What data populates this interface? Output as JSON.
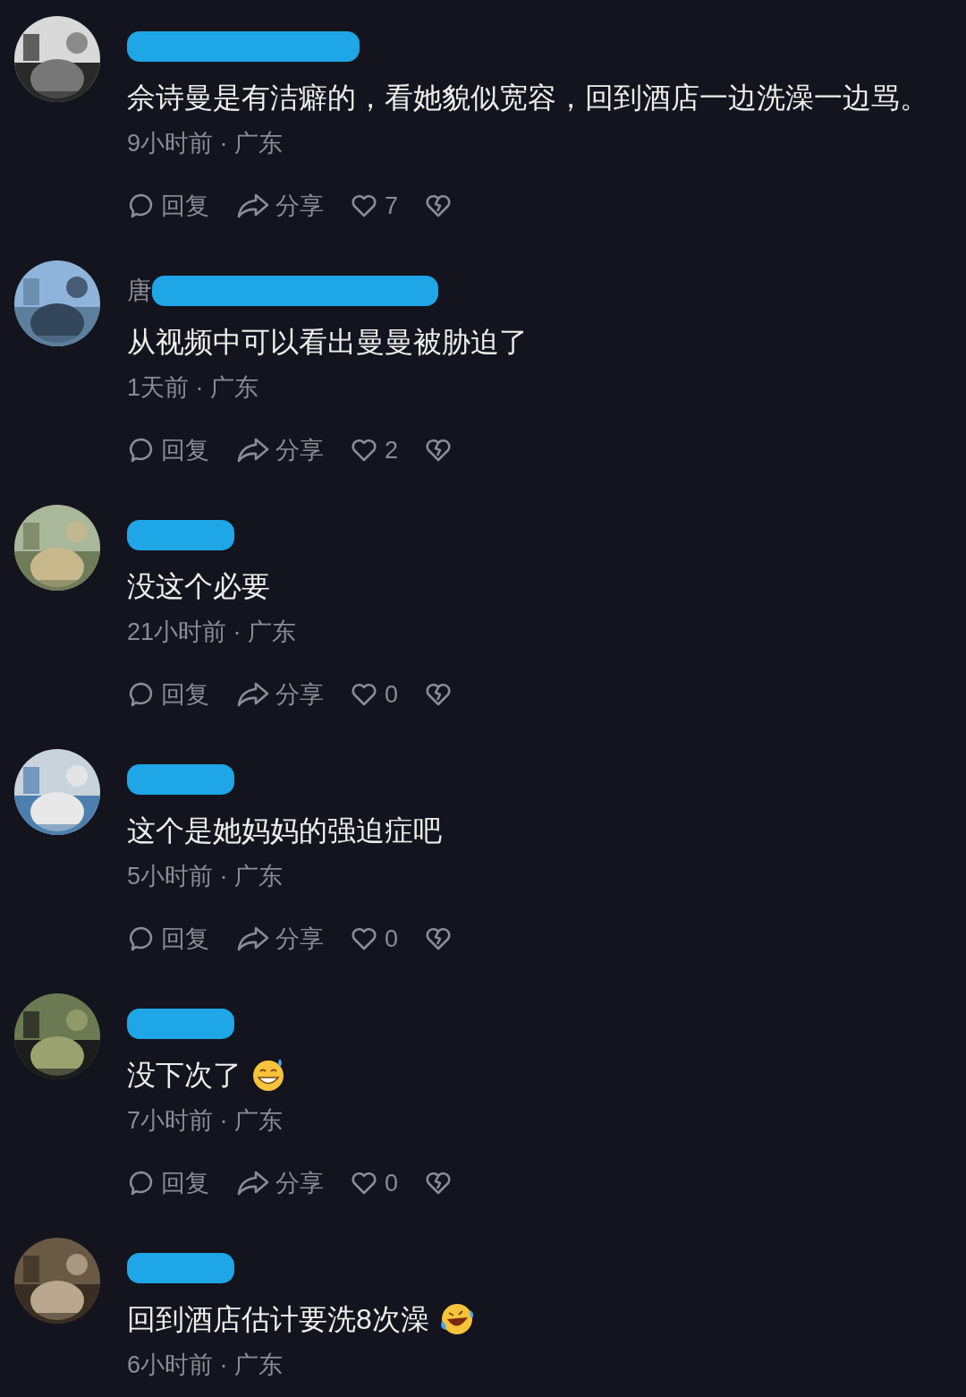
{
  "comments": [
    {
      "kind": "text",
      "text": "佘诗曼是有洁癖的，看她貌似宽容，回到酒店一边洗澡一边骂。",
      "meta": "9小时前 · 广东",
      "reply": "回复",
      "share": "分享",
      "likes": "7",
      "liked": false
    },
    {
      "kind": "text",
      "name_visible": "唐",
      "text": "从视频中可以看出曼曼被胁迫了",
      "meta": "1天前 · 广东",
      "reply": "回复",
      "share": "分享",
      "likes": "2",
      "liked": false
    },
    {
      "kind": "text",
      "text": "没这个必要",
      "meta": "21小时前 · 广东",
      "reply": "回复",
      "share": "分享",
      "likes": "0",
      "liked": false
    },
    {
      "kind": "text",
      "text": "这个是她妈妈的强迫症吧",
      "meta": "5小时前 · 广东",
      "reply": "回复",
      "share": "分享",
      "likes": "0",
      "liked": false
    },
    {
      "kind": "sweat_emoji",
      "text": "没下次了",
      "meta": "7小时前 · 广东",
      "reply": "回复",
      "share": "分享",
      "likes": "0",
      "liked": false
    },
    {
      "kind": "laugh_emoji",
      "text": "回到酒店估计要洗8次澡",
      "meta": "6小时前 · 广东"
    }
  ]
}
